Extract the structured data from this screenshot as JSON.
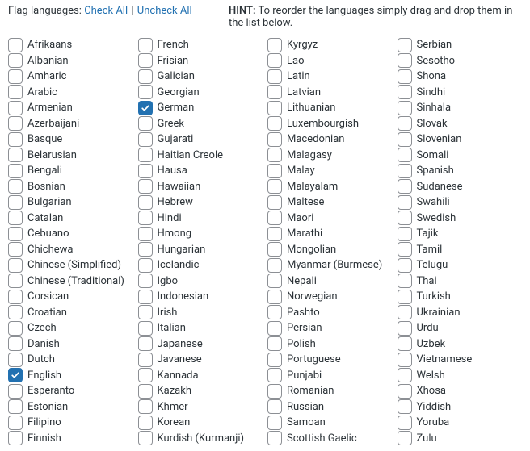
{
  "header": {
    "flag_label": "Flag languages:",
    "check_all": "Check All",
    "separator": "|",
    "uncheck_all": "Uncheck All",
    "hint_label": "HINT:",
    "hint_text": " To reorder the languages simply drag and drop them in the list below."
  },
  "languages": [
    {
      "label": "Afrikaans",
      "checked": false
    },
    {
      "label": "Albanian",
      "checked": false
    },
    {
      "label": "Amharic",
      "checked": false
    },
    {
      "label": "Arabic",
      "checked": false
    },
    {
      "label": "Armenian",
      "checked": false
    },
    {
      "label": "Azerbaijani",
      "checked": false
    },
    {
      "label": "Basque",
      "checked": false
    },
    {
      "label": "Belarusian",
      "checked": false
    },
    {
      "label": "Bengali",
      "checked": false
    },
    {
      "label": "Bosnian",
      "checked": false
    },
    {
      "label": "Bulgarian",
      "checked": false
    },
    {
      "label": "Catalan",
      "checked": false
    },
    {
      "label": "Cebuano",
      "checked": false
    },
    {
      "label": "Chichewa",
      "checked": false
    },
    {
      "label": "Chinese (Simplified)",
      "checked": false
    },
    {
      "label": "Chinese (Traditional)",
      "checked": false
    },
    {
      "label": "Corsican",
      "checked": false
    },
    {
      "label": "Croatian",
      "checked": false
    },
    {
      "label": "Czech",
      "checked": false
    },
    {
      "label": "Danish",
      "checked": false
    },
    {
      "label": "Dutch",
      "checked": false
    },
    {
      "label": "English",
      "checked": true
    },
    {
      "label": "Esperanto",
      "checked": false
    },
    {
      "label": "Estonian",
      "checked": false
    },
    {
      "label": "Filipino",
      "checked": false
    },
    {
      "label": "Finnish",
      "checked": false
    },
    {
      "label": "French",
      "checked": false
    },
    {
      "label": "Frisian",
      "checked": false
    },
    {
      "label": "Galician",
      "checked": false
    },
    {
      "label": "Georgian",
      "checked": false
    },
    {
      "label": "German",
      "checked": true
    },
    {
      "label": "Greek",
      "checked": false
    },
    {
      "label": "Gujarati",
      "checked": false
    },
    {
      "label": "Haitian Creole",
      "checked": false
    },
    {
      "label": "Hausa",
      "checked": false
    },
    {
      "label": "Hawaiian",
      "checked": false
    },
    {
      "label": "Hebrew",
      "checked": false
    },
    {
      "label": "Hindi",
      "checked": false
    },
    {
      "label": "Hmong",
      "checked": false
    },
    {
      "label": "Hungarian",
      "checked": false
    },
    {
      "label": "Icelandic",
      "checked": false
    },
    {
      "label": "Igbo",
      "checked": false
    },
    {
      "label": "Indonesian",
      "checked": false
    },
    {
      "label": "Irish",
      "checked": false
    },
    {
      "label": "Italian",
      "checked": false
    },
    {
      "label": "Japanese",
      "checked": false
    },
    {
      "label": "Javanese",
      "checked": false
    },
    {
      "label": "Kannada",
      "checked": false
    },
    {
      "label": "Kazakh",
      "checked": false
    },
    {
      "label": "Khmer",
      "checked": false
    },
    {
      "label": "Korean",
      "checked": false
    },
    {
      "label": "Kurdish (Kurmanji)",
      "checked": false
    },
    {
      "label": "Kyrgyz",
      "checked": false
    },
    {
      "label": "Lao",
      "checked": false
    },
    {
      "label": "Latin",
      "checked": false
    },
    {
      "label": "Latvian",
      "checked": false
    },
    {
      "label": "Lithuanian",
      "checked": false
    },
    {
      "label": "Luxembourgish",
      "checked": false
    },
    {
      "label": "Macedonian",
      "checked": false
    },
    {
      "label": "Malagasy",
      "checked": false
    },
    {
      "label": "Malay",
      "checked": false
    },
    {
      "label": "Malayalam",
      "checked": false
    },
    {
      "label": "Maltese",
      "checked": false
    },
    {
      "label": "Maori",
      "checked": false
    },
    {
      "label": "Marathi",
      "checked": false
    },
    {
      "label": "Mongolian",
      "checked": false
    },
    {
      "label": "Myanmar (Burmese)",
      "checked": false
    },
    {
      "label": "Nepali",
      "checked": false
    },
    {
      "label": "Norwegian",
      "checked": false
    },
    {
      "label": "Pashto",
      "checked": false
    },
    {
      "label": "Persian",
      "checked": false
    },
    {
      "label": "Polish",
      "checked": false
    },
    {
      "label": "Portuguese",
      "checked": false
    },
    {
      "label": "Punjabi",
      "checked": false
    },
    {
      "label": "Romanian",
      "checked": false
    },
    {
      "label": "Russian",
      "checked": false
    },
    {
      "label": "Samoan",
      "checked": false
    },
    {
      "label": "Scottish Gaelic",
      "checked": false
    },
    {
      "label": "Serbian",
      "checked": false
    },
    {
      "label": "Sesotho",
      "checked": false
    },
    {
      "label": "Shona",
      "checked": false
    },
    {
      "label": "Sindhi",
      "checked": false
    },
    {
      "label": "Sinhala",
      "checked": false
    },
    {
      "label": "Slovak",
      "checked": false
    },
    {
      "label": "Slovenian",
      "checked": false
    },
    {
      "label": "Somali",
      "checked": false
    },
    {
      "label": "Spanish",
      "checked": false
    },
    {
      "label": "Sudanese",
      "checked": false
    },
    {
      "label": "Swahili",
      "checked": false
    },
    {
      "label": "Swedish",
      "checked": false
    },
    {
      "label": "Tajik",
      "checked": false
    },
    {
      "label": "Tamil",
      "checked": false
    },
    {
      "label": "Telugu",
      "checked": false
    },
    {
      "label": "Thai",
      "checked": false
    },
    {
      "label": "Turkish",
      "checked": false
    },
    {
      "label": "Ukrainian",
      "checked": false
    },
    {
      "label": "Urdu",
      "checked": false
    },
    {
      "label": "Uzbek",
      "checked": false
    },
    {
      "label": "Vietnamese",
      "checked": false
    },
    {
      "label": "Welsh",
      "checked": false
    },
    {
      "label": "Xhosa",
      "checked": false
    },
    {
      "label": "Yiddish",
      "checked": false
    },
    {
      "label": "Yoruba",
      "checked": false
    },
    {
      "label": "Zulu",
      "checked": false
    }
  ],
  "layout": {
    "columns": 4,
    "rows_per_column": 26
  }
}
